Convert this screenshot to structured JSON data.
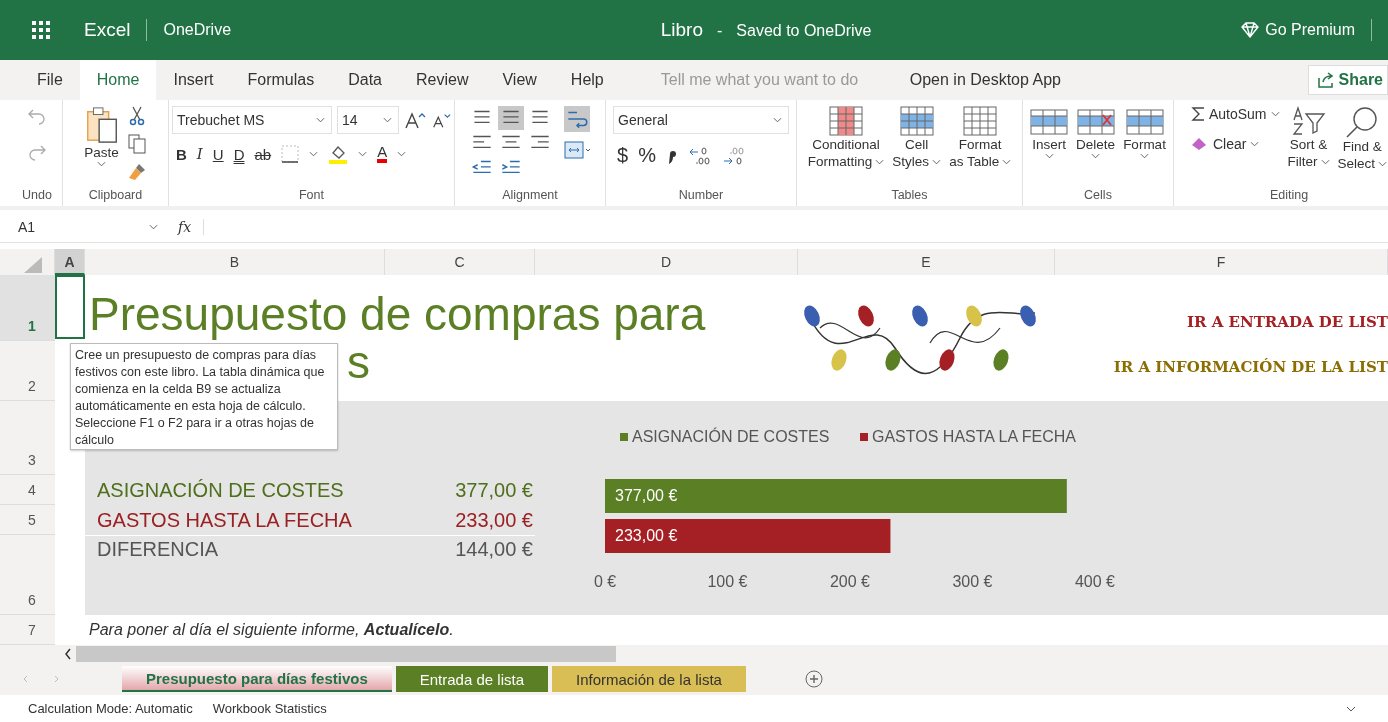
{
  "topbar": {
    "app": "Excel",
    "location": "OneDrive",
    "doc_title": "Libro",
    "separator": "-",
    "save_status": "Saved to OneDrive",
    "premium": "Go Premium"
  },
  "menu_tabs": [
    {
      "label": "File",
      "selected": false
    },
    {
      "label": "Home",
      "selected": true
    },
    {
      "label": "Insert",
      "selected": false
    },
    {
      "label": "Formulas",
      "selected": false
    },
    {
      "label": "Data",
      "selected": false
    },
    {
      "label": "Review",
      "selected": false
    },
    {
      "label": "View",
      "selected": false
    },
    {
      "label": "Help",
      "selected": false
    }
  ],
  "tell_me": {
    "placeholder": "Tell me what you want to do"
  },
  "open_desktop": "Open in Desktop App",
  "share": "Share",
  "ribbon": {
    "groups": [
      "Undo",
      "Clipboard",
      "Font",
      "Alignment",
      "Number",
      "Tables",
      "Cells",
      "Editing"
    ],
    "paste": "Paste",
    "font_name": "Trebuchet MS",
    "font_size": "14",
    "font_buttons": [
      "B",
      "I",
      "U",
      "D",
      "ab"
    ],
    "font_color_letter": "A",
    "number_format": "General",
    "number_buttons": [
      "$",
      "%"
    ],
    "tables": [
      {
        "line1": "Conditional",
        "line2": "Formatting"
      },
      {
        "line1": "Cell",
        "line2": "Styles"
      },
      {
        "line1": "Format",
        "line2": "as Table"
      }
    ],
    "cells": [
      "Insert",
      "Delete",
      "Format"
    ],
    "autosum": "AutoSum",
    "clear": "Clear",
    "sort": {
      "line1": "Sort &",
      "line2": "Filter"
    },
    "find": {
      "line1": "Find &",
      "line2": "Select"
    }
  },
  "formula_bar": {
    "name_box": "A1",
    "fx": "fx"
  },
  "columns": [
    "A",
    "B",
    "C",
    "D",
    "E",
    "F"
  ],
  "rows": [
    "1",
    "2",
    "3",
    "4",
    "5",
    "6",
    "7"
  ],
  "sheet": {
    "title_line1": "Presupuesto de compras para",
    "title_line2": "s",
    "links": [
      "IR A ENTRADA DE LIST",
      "IR A INFORMACIÓN DE LA LIST"
    ],
    "summary": [
      {
        "label": "ASIGNACIÓN DE COSTES",
        "value": "377,00 €",
        "color": "#4f6f1c"
      },
      {
        "label": "GASTOS HASTA LA FECHA",
        "value": "233,00 €",
        "color": "#9c1f23"
      },
      {
        "label": "DIFERENCIA",
        "value": "144,00 €",
        "color": "#555555"
      }
    ],
    "chart_data": {
      "type": "bar",
      "orientation": "horizontal",
      "legend": "top",
      "series": [
        {
          "name": "ASIGNACIÓN DE COSTES",
          "color": "#5b7f24",
          "values": [
            377
          ]
        },
        {
          "name": "GASTOS HASTA LA FECHA",
          "color": "#a52024",
          "values": [
            233
          ]
        }
      ],
      "xlim": [
        0,
        400
      ],
      "xticks": [
        {
          "value": 0,
          "label": "0 €"
        },
        {
          "value": 100,
          "label": "100 €"
        },
        {
          "value": 200,
          "label": "200 €"
        },
        {
          "value": 300,
          "label": "300 €"
        },
        {
          "value": 400,
          "label": "400 €"
        }
      ],
      "value_labels": [
        "377,00 €",
        "233,00 €"
      ]
    },
    "note": "Para poner al día el siguiente informe, **Actualícelo**.",
    "tooltip": "Cree un presupuesto de compras para días festivos con este libro. La tabla dinámica que comienza en la celda B9 se actualiza automáticamente en esta hoja de cálculo. Seleccione F1 o F2 para ir a otras hojas de cálculo"
  },
  "sheet_tabs": [
    {
      "label": "Presupuesto para días festivos",
      "selected": true,
      "color": "#e3a7ab"
    },
    {
      "label": "Entrada de lista",
      "selected": false,
      "color": "#5b7f24"
    },
    {
      "label": "Información de la lista",
      "selected": false,
      "color": "#d9bd55"
    }
  ],
  "status_bar": [
    "Calculation Mode: Automatic",
    "Workbook Statistics"
  ]
}
